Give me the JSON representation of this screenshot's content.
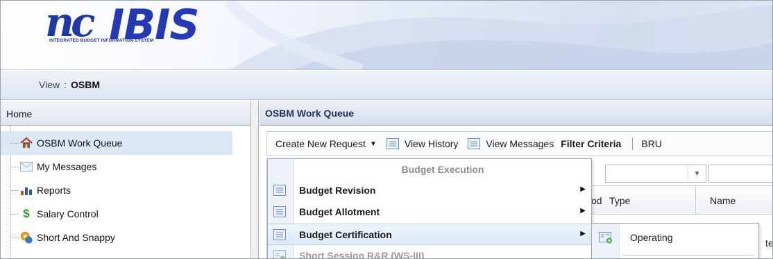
{
  "app": {
    "logo_script": "nc",
    "logo_word": "IBIS",
    "logo_tagline": "INTEGRATED BUDGET INFORMATION SYSTEM"
  },
  "viewbar": {
    "label": "View",
    "separator": ":",
    "value": "OSBM"
  },
  "left_panel": {
    "title": "Home",
    "items": [
      {
        "label": "OSBM Work Queue",
        "icon": "house-icon",
        "selected": true
      },
      {
        "label": "My Messages",
        "icon": "envelope-icon",
        "selected": false
      },
      {
        "label": "Reports",
        "icon": "bar-chart-icon",
        "selected": false
      },
      {
        "label": "Salary Control",
        "icon": "dollar-icon",
        "selected": false
      },
      {
        "label": "Short And Snappy",
        "icon": "gear-coin-icon",
        "selected": false
      }
    ]
  },
  "work_queue": {
    "title": "OSBM Work Queue",
    "toolbar": {
      "create_new_request": "Create New Request",
      "view_history": "View History",
      "view_messages": "View Messages",
      "filter_criteria": "Filter Criteria",
      "bru": "BRU"
    },
    "grid": {
      "columns": [
        "od",
        "Type",
        "Name"
      ],
      "cell_fragment": "tem"
    }
  },
  "create_menu": {
    "section_header": "Budget Execution",
    "items": [
      {
        "label": "Budget Revision",
        "has_submenu": true,
        "active": false,
        "disabled": false
      },
      {
        "label": "Budget Allotment",
        "has_submenu": true,
        "active": false,
        "disabled": false
      },
      {
        "label": "Budget Certification",
        "has_submenu": true,
        "active": true,
        "disabled": false
      },
      {
        "label": "Short Session R&R (WS-III)",
        "has_submenu": false,
        "active": false,
        "disabled": true
      }
    ],
    "submenu": {
      "items": [
        {
          "label": "Operating"
        }
      ]
    }
  },
  "colors": {
    "brand_blue": "#2438b8",
    "selected_row": "#dce8f6",
    "menu_disabled": "#9a9a9a"
  }
}
